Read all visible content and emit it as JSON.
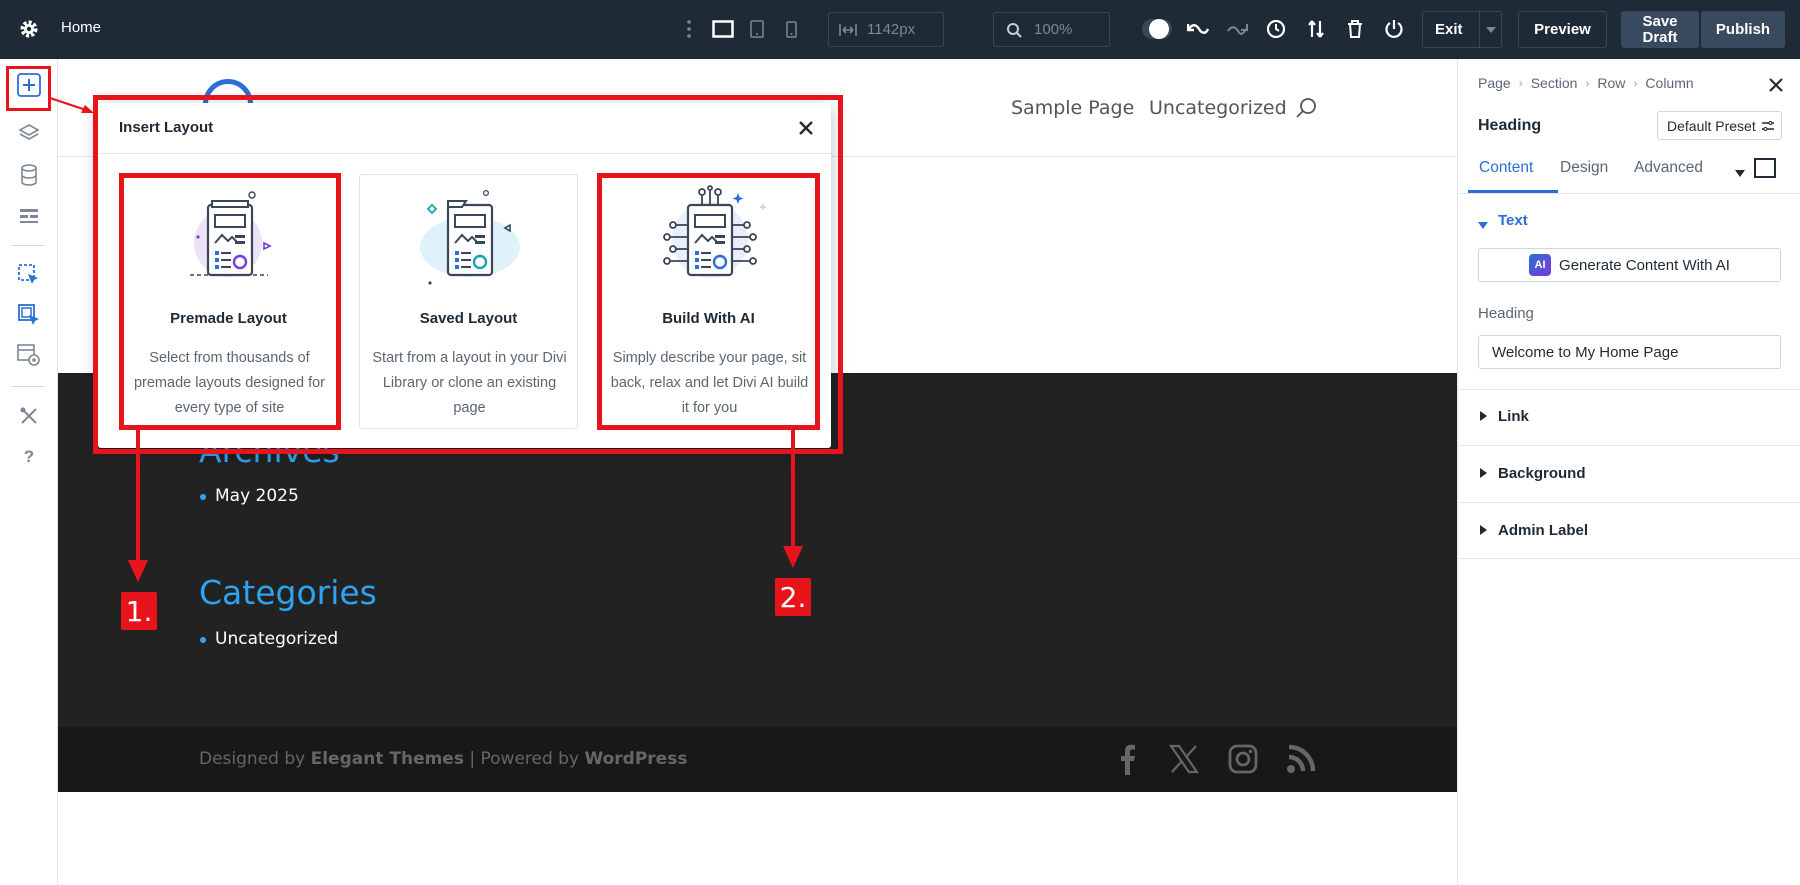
{
  "topbar": {
    "page_name": "Home",
    "width_value": "1142px",
    "zoom_value": "100%",
    "exit_label": "Exit",
    "preview_label": "Preview",
    "save_draft_label": "Save Draft",
    "publish_label": "Publish"
  },
  "site": {
    "nav": [
      "Sample Page",
      "Uncategorized"
    ],
    "archives_title": "Archives",
    "archives_items": [
      "May 2025"
    ],
    "categories_title": "Categories",
    "categories_items": [
      "Uncategorized"
    ],
    "footer_designed": "Designed by",
    "footer_elegant": "Elegant Themes",
    "footer_powered": "| Powered by",
    "footer_wordpress": "WordPress"
  },
  "modal": {
    "title": "Insert Layout",
    "cards": [
      {
        "title": "Premade Layout",
        "desc": "Select from thousands of premade layouts designed for every type of site"
      },
      {
        "title": "Saved Layout",
        "desc": "Start from a layout in your Divi Library or clone an existing page"
      },
      {
        "title": "Build With AI",
        "desc": "Simply describe your page, sit back, relax and let Divi AI build it for you"
      }
    ]
  },
  "annotations": {
    "label1": "1.",
    "label2": "2."
  },
  "right_panel": {
    "breadcrumb": [
      "Page",
      "Section",
      "Row",
      "Column"
    ],
    "module_name": "Heading",
    "preset_label": "Default Preset",
    "tabs": [
      "Content",
      "Design",
      "Advanced"
    ],
    "text_section": "Text",
    "ai_button": "Generate Content With AI",
    "ai_badge": "AI",
    "heading_label": "Heading",
    "heading_value": "Welcome to My Home Page",
    "sections": [
      "Link",
      "Background",
      "Admin Label"
    ]
  },
  "colors": {
    "accent": "#2b6fd6",
    "annotation": "#e8141c",
    "topbar": "#1f2a37",
    "link_blue": "#2ea3f2"
  }
}
